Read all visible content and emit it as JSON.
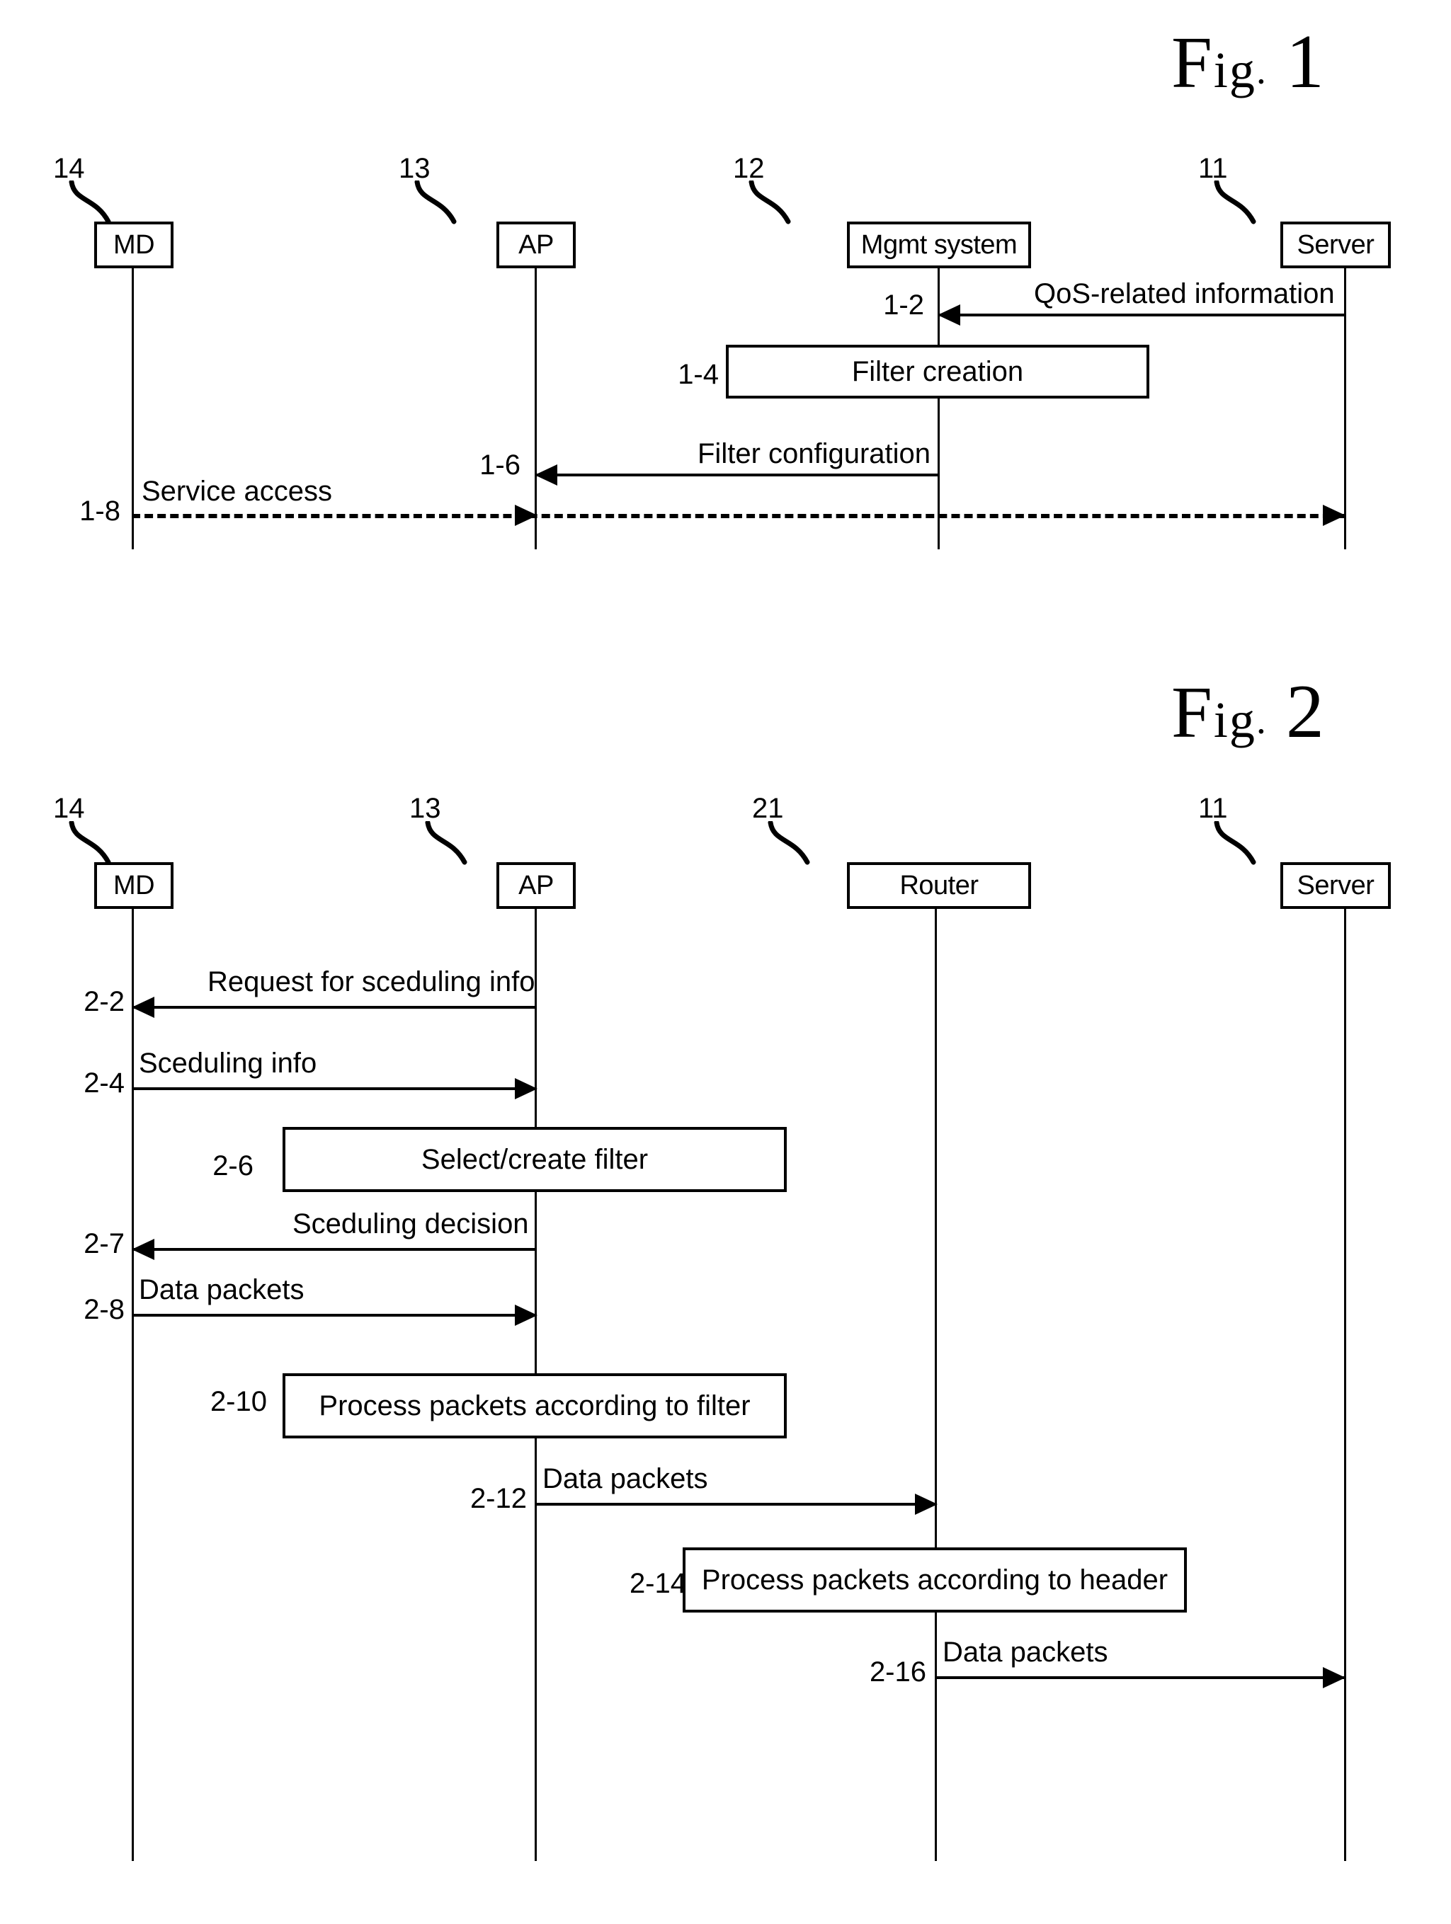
{
  "document": {
    "type": "patent-sequence-diagrams",
    "background_color": "#ffffff",
    "ink_color": "#000000"
  },
  "figures": [
    {
      "id": "fig1",
      "title_prefix": "F",
      "title_ig": "ig",
      "title_dot": ".",
      "title_number": "1",
      "title_full": "Fig. 1",
      "participants": [
        {
          "ref": "14",
          "label": "MD"
        },
        {
          "ref": "13",
          "label": "AP"
        },
        {
          "ref": "12",
          "label": "Mgmt system"
        },
        {
          "ref": "11",
          "label": "Server"
        }
      ],
      "messages": [
        {
          "step": "1-2",
          "label": "QoS-related information",
          "from": "Server",
          "to": "Mgmt system",
          "direction": "left",
          "style": "solid"
        },
        {
          "step": "1-6",
          "label": "Filter configuration",
          "from": "Mgmt system",
          "to": "AP",
          "direction": "left",
          "style": "solid"
        },
        {
          "step": "1-8",
          "label": "Service access",
          "from": "MD",
          "to": "Server",
          "direction": "right",
          "style": "dashed"
        }
      ],
      "actions": [
        {
          "step": "1-4",
          "label": "Filter creation",
          "on": "Mgmt system"
        }
      ]
    },
    {
      "id": "fig2",
      "title_prefix": "F",
      "title_ig": "ig",
      "title_dot": ".",
      "title_number": "2",
      "title_full": "Fig. 2",
      "participants": [
        {
          "ref": "14",
          "label": "MD"
        },
        {
          "ref": "13",
          "label": "AP"
        },
        {
          "ref": "21",
          "label": "Router"
        },
        {
          "ref": "11",
          "label": "Server"
        }
      ],
      "messages": [
        {
          "step": "2-2",
          "label": "Request for sceduling info",
          "from": "AP",
          "to": "MD",
          "direction": "left",
          "style": "solid"
        },
        {
          "step": "2-4",
          "label": "Sceduling info",
          "from": "MD",
          "to": "AP",
          "direction": "right",
          "style": "solid"
        },
        {
          "step": "2-7",
          "label": "Sceduling decision",
          "from": "AP",
          "to": "MD",
          "direction": "left",
          "style": "solid"
        },
        {
          "step": "2-8",
          "label": "Data packets",
          "from": "MD",
          "to": "AP",
          "direction": "right",
          "style": "solid"
        },
        {
          "step": "2-12",
          "label": "Data packets",
          "from": "AP",
          "to": "Router",
          "direction": "right",
          "style": "solid"
        },
        {
          "step": "2-16",
          "label": "Data packets",
          "from": "Router",
          "to": "Server",
          "direction": "right",
          "style": "solid"
        }
      ],
      "actions": [
        {
          "step": "2-6",
          "label": "Select/create filter",
          "on": "AP"
        },
        {
          "step": "2-10",
          "label": "Process packets according to filter",
          "on": "AP"
        },
        {
          "step": "2-14",
          "label": "Process packets according to header",
          "on": "Router"
        }
      ]
    }
  ]
}
